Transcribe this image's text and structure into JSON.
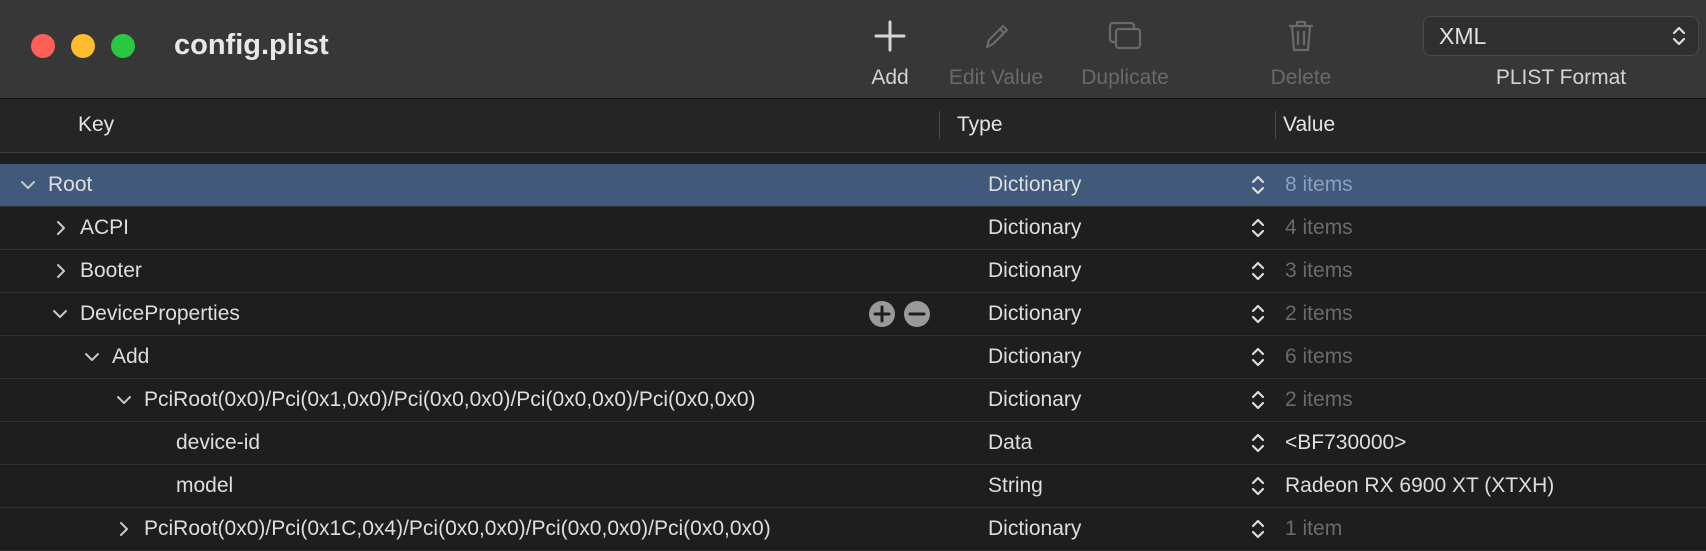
{
  "window": {
    "title": "config.plist"
  },
  "toolbar": {
    "add_label": "Add",
    "edit_label": "Edit Value",
    "duplicate_label": "Duplicate",
    "delete_label": "Delete",
    "format_value": "XML",
    "format_label": "PLIST Format"
  },
  "header": {
    "key": "Key",
    "type": "Type",
    "value": "Value"
  },
  "rows": [
    {
      "key": "Root",
      "type": "Dictionary",
      "value": "8 items",
      "expanded": true,
      "selected": true
    },
    {
      "key": "ACPI",
      "type": "Dictionary",
      "value": "4 items",
      "expanded": false
    },
    {
      "key": "Booter",
      "type": "Dictionary",
      "value": "3 items",
      "expanded": false
    },
    {
      "key": "DeviceProperties",
      "type": "Dictionary",
      "value": "2 items",
      "expanded": true
    },
    {
      "key": "Add",
      "type": "Dictionary",
      "value": "6 items",
      "expanded": true
    },
    {
      "key": "PciRoot(0x0)/Pci(0x1,0x0)/Pci(0x0,0x0)/Pci(0x0,0x0)/Pci(0x0,0x0)",
      "type": "Dictionary",
      "value": "2 items",
      "expanded": true
    },
    {
      "key": "device-id",
      "type": "Data",
      "value": "<BF730000>"
    },
    {
      "key": "model",
      "type": "String",
      "value": "Radeon RX 6900 XT (XTXH)"
    },
    {
      "key": "PciRoot(0x0)/Pci(0x1C,0x4)/Pci(0x0,0x0)/Pci(0x0,0x0)/Pci(0x0,0x0)",
      "type": "Dictionary",
      "value": "1 item",
      "expanded": false
    }
  ],
  "colors": {
    "accent_selected": "#41597a",
    "close": "#ff5f57",
    "minimize": "#febc2e",
    "zoom": "#28c840"
  },
  "icons": [
    "plus-icon",
    "pencil-icon",
    "duplicate-icon",
    "trash-icon",
    "chevron-updown-icon",
    "add-circle-icon",
    "remove-circle-icon"
  ]
}
